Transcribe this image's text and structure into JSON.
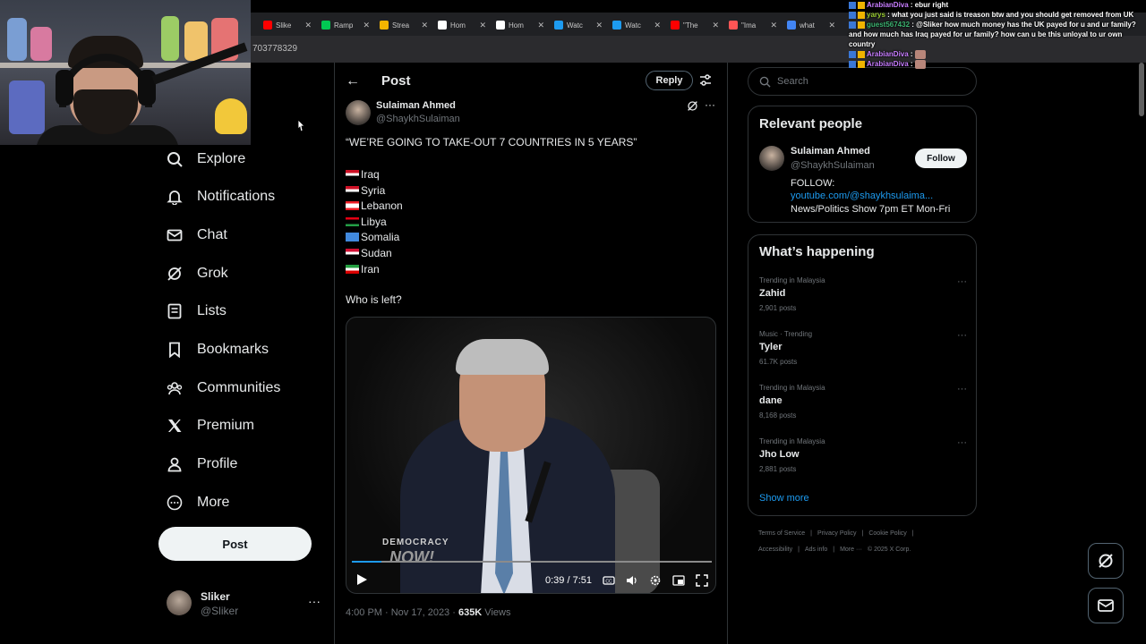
{
  "browser": {
    "tabs": [
      {
        "label": "Slike",
        "color": "#ff0000"
      },
      {
        "label": "Ramp",
        "color": "#00c853"
      },
      {
        "label": "Strea",
        "color": "#f4b400"
      },
      {
        "label": "Hom",
        "color": "#ffffff"
      },
      {
        "label": "Hom",
        "color": "#ffffff"
      },
      {
        "label": "Watc",
        "color": "#1d9bf0"
      },
      {
        "label": "Watc",
        "color": "#1d9bf0"
      },
      {
        "label": "\"The",
        "color": "#ff0000"
      },
      {
        "label": "\"Ima",
        "color": "#ff5555"
      },
      {
        "label": "what",
        "color": "#4285f4"
      }
    ],
    "url": "703778329"
  },
  "nav": {
    "items": [
      {
        "label": "Explore",
        "icon": "search-icon"
      },
      {
        "label": "Notifications",
        "icon": "bell-icon"
      },
      {
        "label": "Chat",
        "icon": "mail-icon"
      },
      {
        "label": "Grok",
        "icon": "grok-icon"
      },
      {
        "label": "Lists",
        "icon": "list-icon"
      },
      {
        "label": "Bookmarks",
        "icon": "bookmark-icon"
      },
      {
        "label": "Communities",
        "icon": "communities-icon"
      },
      {
        "label": "Premium",
        "icon": "x-logo-icon"
      },
      {
        "label": "Profile",
        "icon": "profile-icon"
      },
      {
        "label": "More",
        "icon": "more-circle-icon"
      }
    ],
    "post_button": "Post",
    "account": {
      "name": "Sliker",
      "handle": "@Sliker"
    }
  },
  "post_header": {
    "title": "Post",
    "reply_label": "Reply"
  },
  "tweet": {
    "author_name": "Sulaiman Ahmed",
    "author_handle": "@ShaykhSulaiman",
    "headline": "“WE’RE GOING TO TAKE-OUT 7 COUNTRIES IN 5 YEARS”",
    "countries": [
      "Iraq",
      "Syria",
      "Lebanon",
      "Libya",
      "Somalia",
      "Sudan",
      "Iran"
    ],
    "closing": "Who is left?",
    "video": {
      "time": "0:39 / 7:51",
      "progress": 0.083,
      "logo_top": "DEMOCRACY",
      "logo_bottom": "NOW!"
    },
    "meta_date": "4:00 PM · Nov 17, 2023 · ",
    "views_count": "635K",
    "views_label": " Views"
  },
  "right": {
    "search_placeholder": "Search",
    "relevant_title": "Relevant people",
    "person": {
      "name": "Sulaiman Ahmed",
      "handle": "@ShaykhSulaiman",
      "follow": "Follow",
      "bio_line1": "FOLLOW:",
      "bio_link": "youtube.com/@shaykhsulaima...",
      "bio_line3": "News/Politics Show 7pm ET Mon-Fri"
    },
    "happening_title": "What’s happening",
    "trends": [
      {
        "context": "Trending in Malaysia",
        "topic": "Zahid",
        "count": "2,901 posts"
      },
      {
        "context": "Music · Trending",
        "topic": "Tyler",
        "count": "61.7K posts"
      },
      {
        "context": "Trending in Malaysia",
        "topic": "dane",
        "count": "8,168 posts"
      },
      {
        "context": "Trending in Malaysia",
        "topic": "Jho Low",
        "count": "2,881 posts"
      }
    ],
    "show_more": "Show more",
    "footer_line1": [
      "Terms of Service",
      "|",
      "Privacy Policy",
      "|",
      "Cookie Policy",
      "|"
    ],
    "footer_line2": [
      "Accessibility",
      "|",
      "Ads info",
      "|",
      "More ···",
      "© 2025 X Corp."
    ]
  },
  "chat": [
    {
      "user": "ArabianDiva",
      "user_color": "#c77dff",
      "text": " : ebur right"
    },
    {
      "user": "yarys",
      "user_color": "#9acd32",
      "text": " : what you just said is treason btw and you should get removed from UK"
    },
    {
      "user": "guest567432",
      "user_color": "#3cb371",
      "text": " : @Sliker how much money has the UK payed for u and ur family? and how much has Iraq payed for ur family? how can u be this unloyal to ur own country"
    },
    {
      "user": "ArabianDiva",
      "user_color": "#c77dff",
      "text": " :"
    },
    {
      "user": "ArabianDiva",
      "user_color": "#c77dff",
      "text": " :"
    }
  ]
}
